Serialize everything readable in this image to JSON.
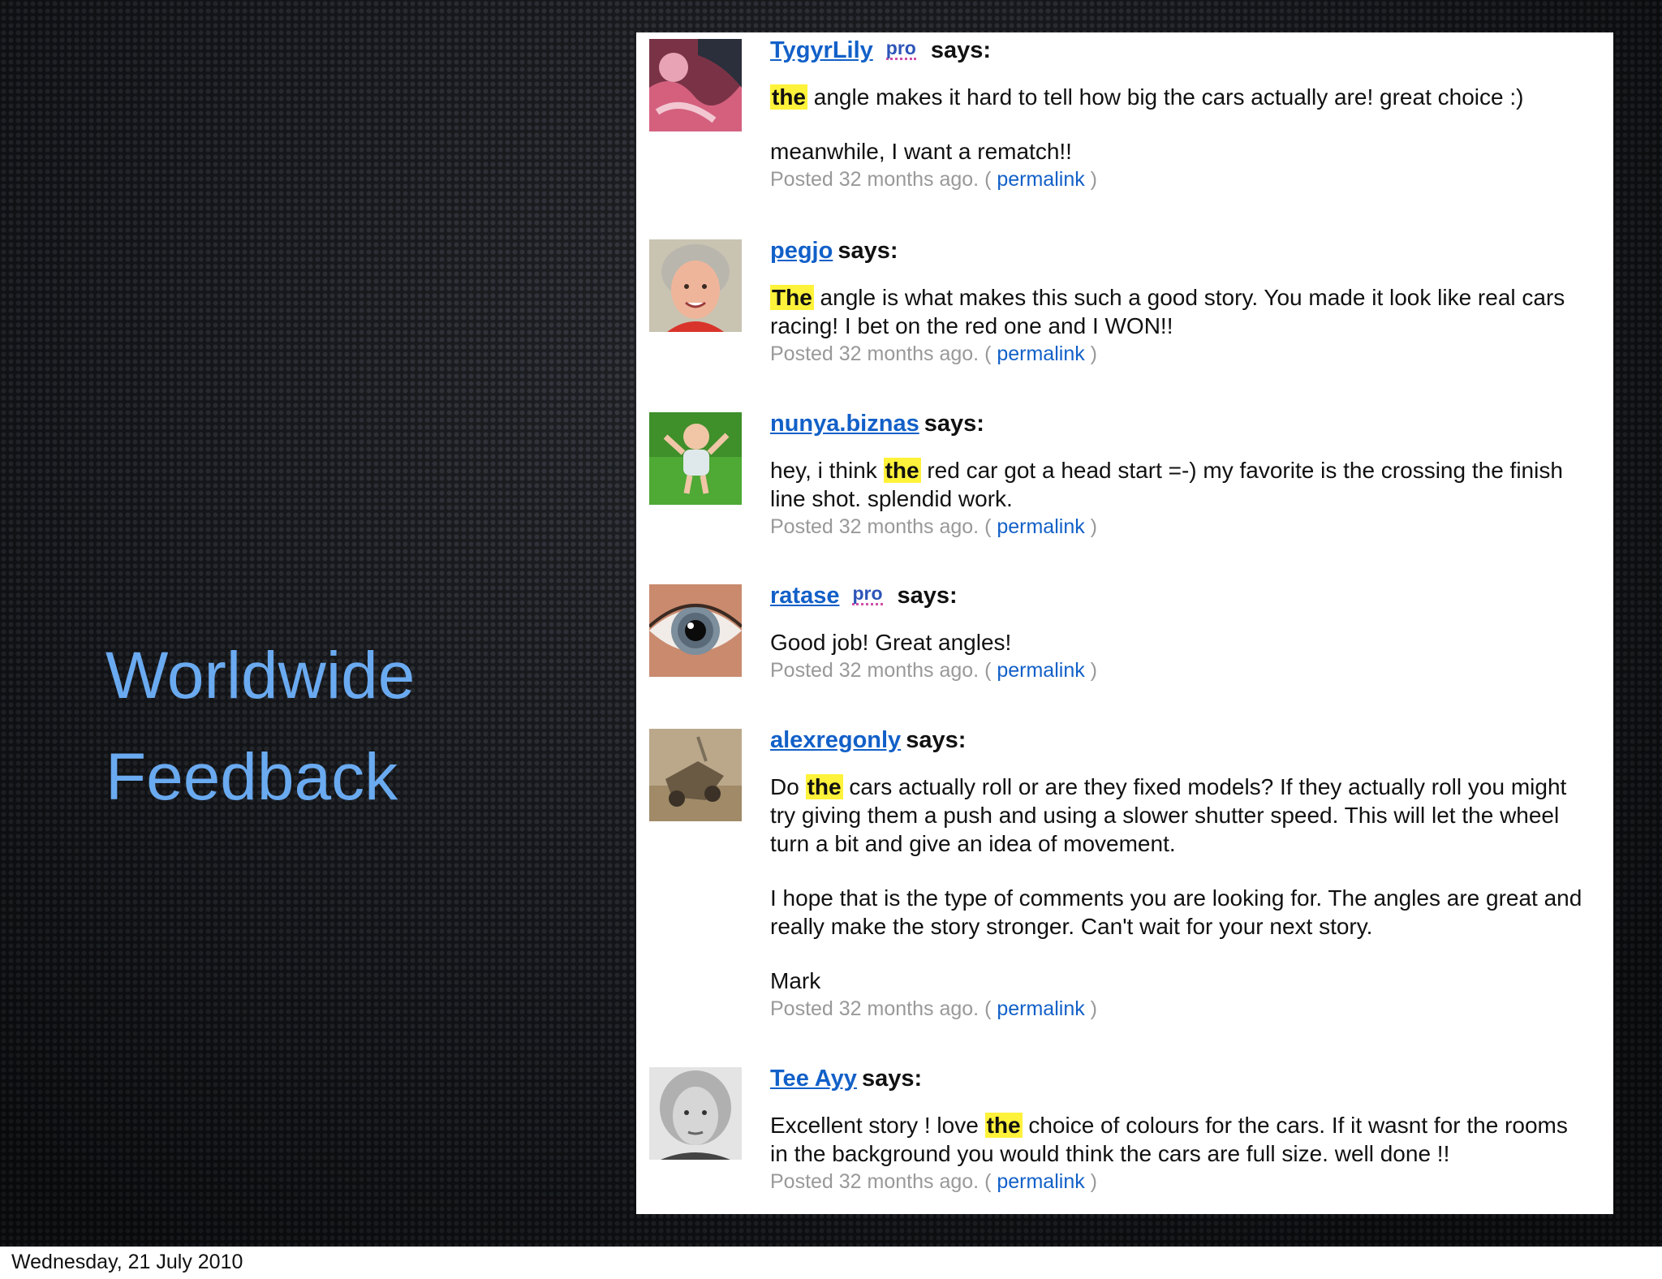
{
  "slide": {
    "title_line1": "Worldwide",
    "title_line2": "Feedback",
    "footer_date": "Wednesday, 21 July 2010"
  },
  "comments": [
    {
      "user": "TygyrLily",
      "pro": "pro",
      "says": "says:",
      "paragraphs": [
        {
          "before": "",
          "highlight": "the",
          "after": " angle makes it hard to tell how big the cars actually are! great choice :)"
        },
        {
          "before": "meanwhile, I want a rematch!!",
          "highlight": "",
          "after": ""
        }
      ],
      "posted": "Posted 32 months ago. (",
      "permalink": "permalink",
      "close": ")"
    },
    {
      "user": "pegjo",
      "pro": "",
      "says": "says:",
      "paragraphs": [
        {
          "before": "",
          "highlight": "The",
          "after": " angle is what makes this such a good story. You made it look like real cars racing! I bet on the red one and I WON!!"
        }
      ],
      "posted": "Posted 32 months ago. (",
      "permalink": "permalink",
      "close": ")"
    },
    {
      "user": "nunya.biznas",
      "pro": "",
      "says": "says:",
      "paragraphs": [
        {
          "before": "hey, i think ",
          "highlight": "the",
          "after": " red car got a head start =-) my favorite is the crossing the finish line shot. splendid work."
        }
      ],
      "posted": "Posted 32 months ago. (",
      "permalink": "permalink",
      "close": ")"
    },
    {
      "user": "ratase",
      "pro": "pro",
      "says": "says:",
      "paragraphs": [
        {
          "before": "Good job! Great angles!",
          "highlight": "",
          "after": ""
        }
      ],
      "posted": "Posted 32 months ago. (",
      "permalink": "permalink",
      "close": ")"
    },
    {
      "user": "alexregonly",
      "pro": "",
      "says": "says:",
      "paragraphs": [
        {
          "before": "Do ",
          "highlight": "the",
          "after": " cars actually roll or are they fixed models? If they actually roll you might try giving them a push and using a slower shutter speed. This will let the wheel turn a bit and give an idea of movement."
        },
        {
          "before": "I hope that is the type of comments you are looking for. The angles are great and really make the story stronger. Can't wait for your next story.",
          "highlight": "",
          "after": ""
        },
        {
          "before": "Mark",
          "highlight": "",
          "after": ""
        }
      ],
      "posted": "Posted 32 months ago. (",
      "permalink": "permalink",
      "close": ")"
    },
    {
      "user": "Tee Ayy",
      "pro": "",
      "says": "says:",
      "paragraphs": [
        {
          "before": "Excellent story ! love ",
          "highlight": "the",
          "after": " choice of colours for the cars. If it wasnt for the rooms in the background you would think the cars are full size. well done !!"
        }
      ],
      "posted": "Posted 32 months ago. (",
      "permalink": "permalink",
      "close": ")"
    }
  ]
}
